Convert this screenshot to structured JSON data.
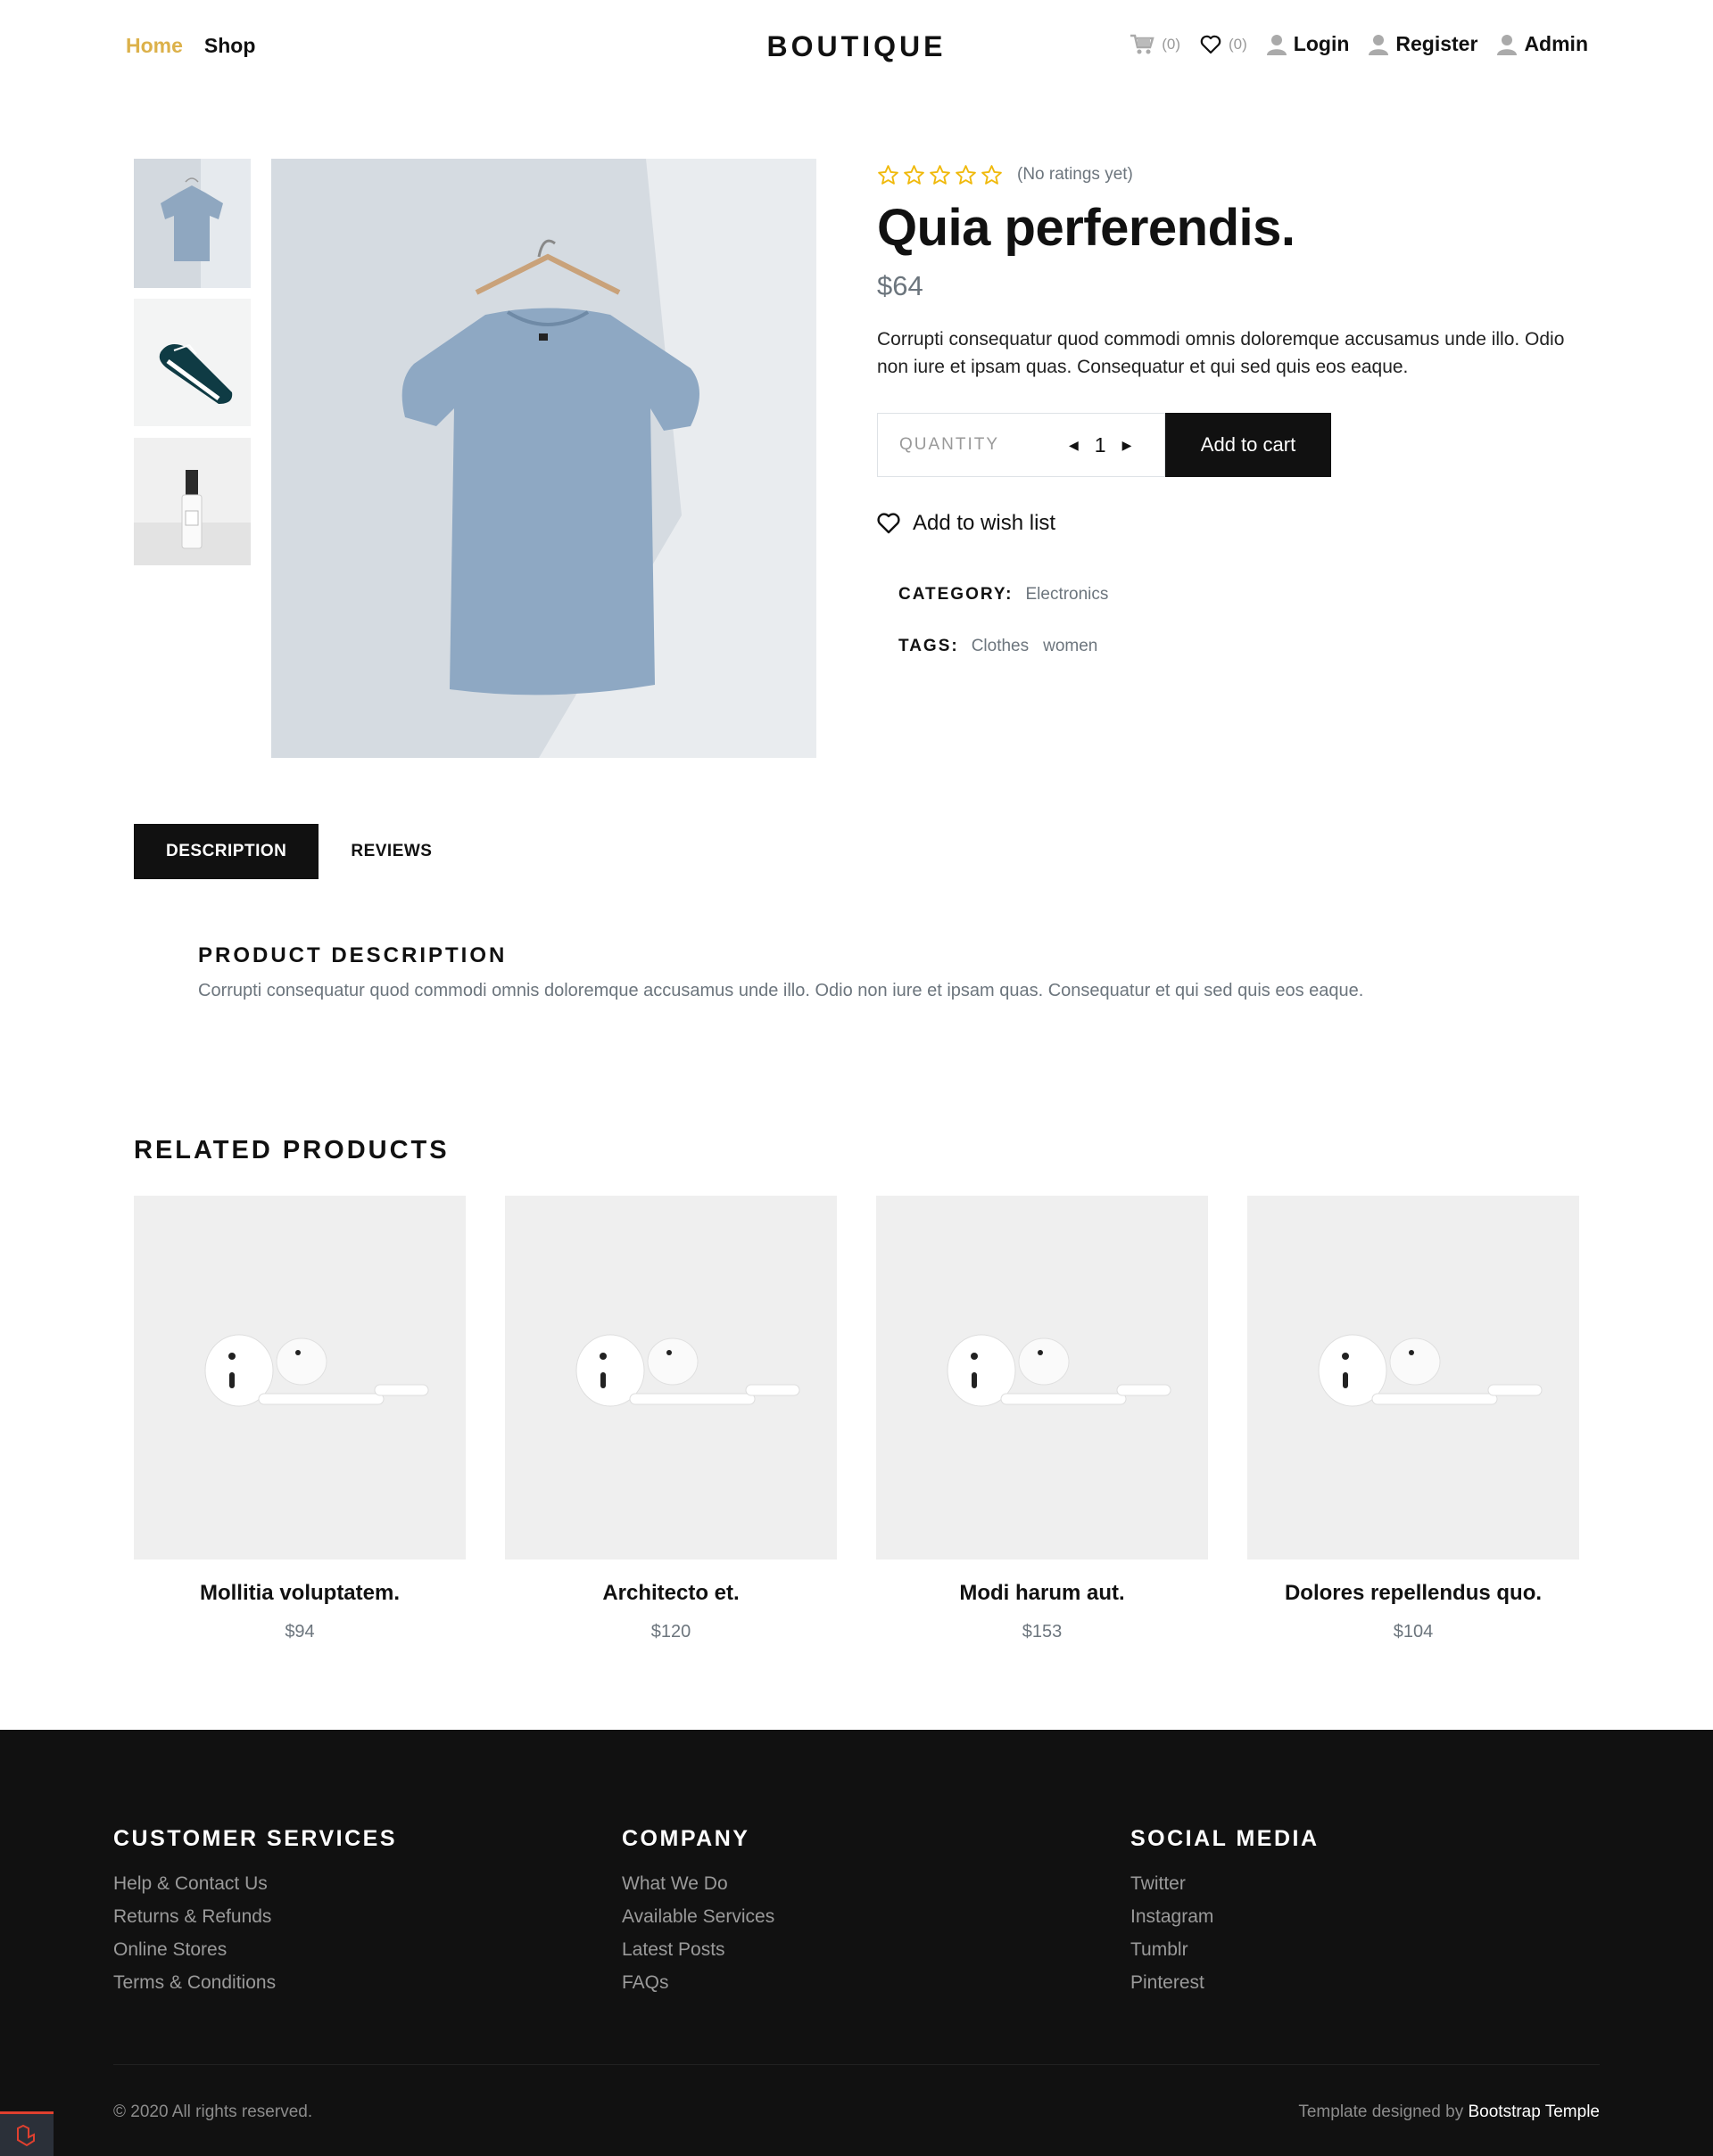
{
  "nav": {
    "links": [
      "Home",
      "Shop"
    ],
    "brand": "BOUTIQUE",
    "cart_count": "(0)",
    "wishlist_count": "(0)",
    "login": "Login",
    "register": "Register",
    "admin": "Admin"
  },
  "product": {
    "ratings_note": "(No ratings yet)",
    "stars_filled": 0,
    "stars_total": 5,
    "title": "Quia perferendis.",
    "price": "$64",
    "description": "Corrupti consequatur quod commodi omnis doloremque accusamus unde illo. Odio non iure et ipsam quas. Consequatur et qui sed quis eos eaque.",
    "quantity_label": "QUANTITY",
    "quantity": "1",
    "add_to_cart": "Add to cart",
    "wishlist_label": "Add to wish list",
    "category_key": "CATEGORY:",
    "category": "Electronics",
    "tags_key": "TAGS:",
    "tags": [
      "Clothes",
      "women"
    ]
  },
  "tabs": [
    "DESCRIPTION",
    "REVIEWS"
  ],
  "description_section": {
    "heading": "PRODUCT DESCRIPTION",
    "text": "Corrupti consequatur quod commodi omnis doloremque accusamus unde illo. Odio non iure et ipsam quas. Consequatur et qui sed quis eos eaque."
  },
  "related": {
    "heading": "RELATED PRODUCTS",
    "items": [
      {
        "name": "Mollitia voluptatem.",
        "price": "$94"
      },
      {
        "name": "Architecto et.",
        "price": "$120"
      },
      {
        "name": "Modi harum aut.",
        "price": "$153"
      },
      {
        "name": "Dolores repellendus quo.",
        "price": "$104"
      }
    ]
  },
  "footer": {
    "columns": [
      {
        "title": "CUSTOMER SERVICES",
        "links": [
          "Help & Contact Us",
          "Returns & Refunds",
          "Online Stores",
          "Terms & Conditions"
        ]
      },
      {
        "title": "COMPANY",
        "links": [
          "What We Do",
          "Available Services",
          "Latest Posts",
          "FAQs"
        ]
      },
      {
        "title": "SOCIAL MEDIA",
        "links": [
          "Twitter",
          "Instagram",
          "Tumblr",
          "Pinterest"
        ]
      }
    ],
    "copyright": "© 2020 All rights reserved.",
    "credit_prefix": "Template designed by",
    "credit_link": "Bootstrap Temple"
  },
  "colors": {
    "accent": "#dcb14a",
    "dark": "#111111",
    "muted": "#6c757d",
    "star": "#f0b90b"
  }
}
